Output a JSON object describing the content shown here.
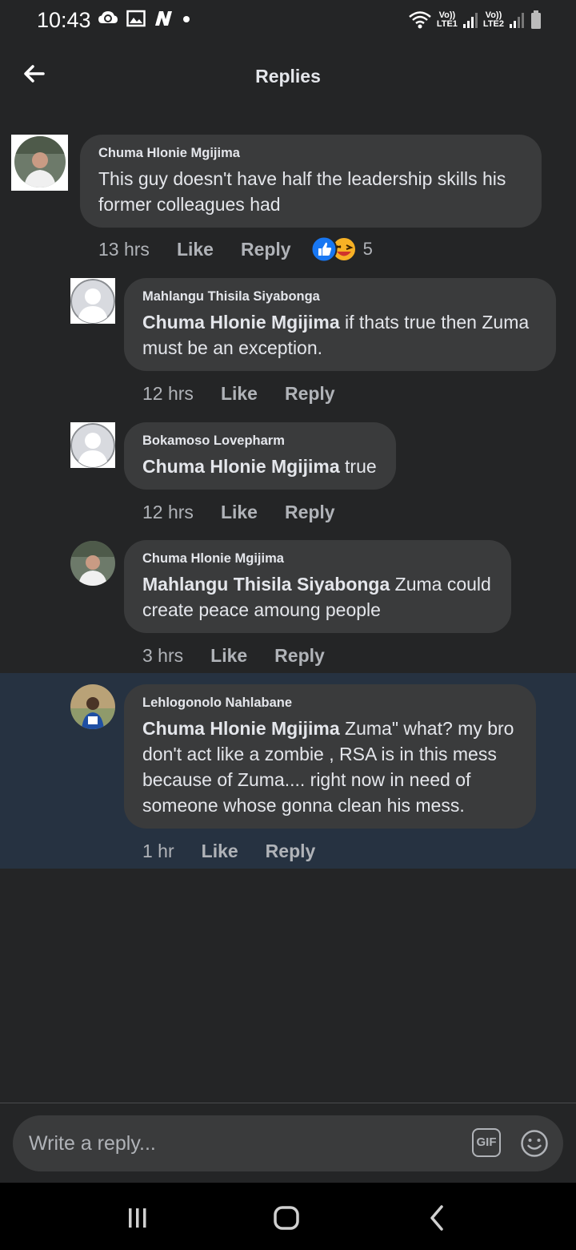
{
  "status_bar": {
    "time": "10:43",
    "net1": "LTE1",
    "net2": "LTE2",
    "volte": "Vo))"
  },
  "header": {
    "title": "Replies"
  },
  "comments": [
    {
      "author": "Chuma Hlonie Mgijima",
      "mention": "",
      "text": "This guy doesn't have half the leadership skills his former colleagues had",
      "time": "13 hrs",
      "like": "Like",
      "reply": "Reply",
      "reaction_count": "5"
    },
    {
      "author": "Mahlangu Thisila Siyabonga",
      "mention": "Chuma Hlonie Mgijima",
      "text": " if thats true then Zuma must be an exception.",
      "time": "12 hrs",
      "like": "Like",
      "reply": "Reply"
    },
    {
      "author": "Bokamoso Lovepharm",
      "mention": "Chuma Hlonie Mgijima",
      "text": " true",
      "time": "12 hrs",
      "like": "Like",
      "reply": "Reply"
    },
    {
      "author": "Chuma Hlonie Mgijima",
      "mention": "Mahlangu Thisila Siyabonga",
      "text": " Zuma could create peace amoung people",
      "time": "3 hrs",
      "like": "Like",
      "reply": "Reply"
    },
    {
      "author": "Lehlogonolo Nahlabane",
      "mention": "Chuma Hlonie Mgijima",
      "text": " Zuma\" what? my bro don't act like a zombie , RSA is in this mess because of Zuma.... right now in need of someone whose gonna clean his mess.",
      "time": "1 hr",
      "like": "Like",
      "reply": "Reply"
    }
  ],
  "reply_bar": {
    "placeholder": "Write a reply...",
    "gif_label": "GIF"
  },
  "colors": {
    "background": "#242526",
    "bubble": "#3a3b3c",
    "highlight": "#263241",
    "like_blue": "#1877f2",
    "haha_yellow": "#f7b125"
  }
}
